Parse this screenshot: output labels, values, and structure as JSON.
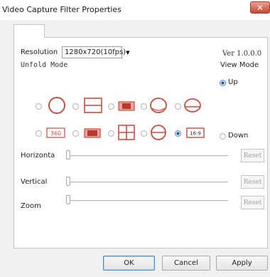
{
  "window": {
    "title": "Video Capture Filter Properties",
    "close_glyph": "✕"
  },
  "tab": {
    "label": ""
  },
  "resolution": {
    "label": "Resolution",
    "selected": "1280x720(10fps)"
  },
  "version": "Ver 1.0.0.0",
  "unfold_mode": {
    "label": "Unfold Mode",
    "options": [
      {
        "icon": "circle-fisheye-icon",
        "checked": false
      },
      {
        "icon": "horizontal-split-icon",
        "checked": false
      },
      {
        "icon": "panorama-strip-icon",
        "checked": false
      },
      {
        "icon": "ellipse-dome-icon",
        "checked": false
      },
      {
        "icon": "oval-slice-icon",
        "checked": false
      },
      {
        "icon": "panorama-360-icon",
        "checked": false,
        "text": "360"
      },
      {
        "icon": "panorama-wide-icon",
        "checked": false
      },
      {
        "icon": "quad-grid-icon",
        "checked": false
      },
      {
        "icon": "sphere-section-icon",
        "checked": false
      },
      {
        "icon": "aspect-16-9-icon",
        "checked": true,
        "text": "16:9"
      }
    ]
  },
  "view_mode": {
    "label": "View Mode",
    "options": [
      {
        "label": "Up",
        "checked": true
      },
      {
        "label": "Down",
        "checked": false
      }
    ]
  },
  "sliders": [
    {
      "label": "Horizonta",
      "value": 0,
      "reset_label": "Reset"
    },
    {
      "label": "Vertical",
      "value": 0,
      "reset_label": "Reset"
    },
    {
      "label": "Zoom",
      "value": 0,
      "reset_label": "Reset"
    }
  ],
  "buttons": {
    "ok": "OK",
    "cancel": "Cancel",
    "apply": "Apply"
  },
  "colors": {
    "close_button": "#c84830",
    "icon_red": "#d04a3a",
    "selected_radio": "#1f4f8f"
  }
}
